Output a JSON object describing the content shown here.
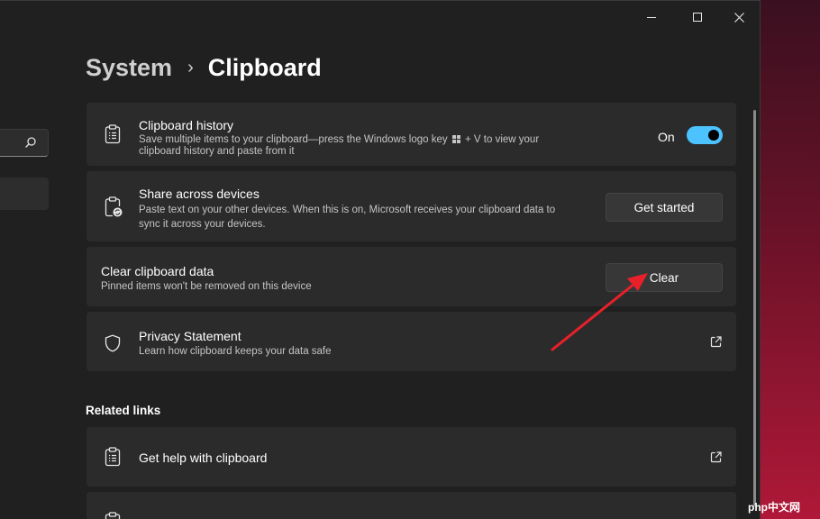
{
  "window": {
    "minimize_icon": "minimize-icon",
    "maximize_icon": "maximize-icon",
    "close_icon": "close-icon"
  },
  "breadcrumb": {
    "parent": "System",
    "separator": "›",
    "current": "Clipboard"
  },
  "settings": {
    "clipboard_history": {
      "title": "Clipboard history",
      "desc_line1": "Save multiple items to your clipboard—press the Windows logo key",
      "desc_key": "+ V to view your",
      "desc_line2": "clipboard history and paste from it",
      "toggle_label": "On",
      "toggle_on": true,
      "icon": "clipboard-list-icon"
    },
    "share_devices": {
      "title": "Share across devices",
      "desc_line1": "Paste text on your other devices. When this is on, Microsoft receives your clipboard data to",
      "desc_line2": "sync it across your devices.",
      "button": "Get started",
      "icon": "clipboard-sync-icon"
    },
    "clear_data": {
      "title": "Clear clipboard data",
      "desc": "Pinned items won't be removed on this device",
      "button": "Clear"
    },
    "privacy": {
      "title": "Privacy Statement",
      "desc": "Learn how clipboard keeps your data safe",
      "icon": "shield-icon"
    }
  },
  "related": {
    "title": "Related links",
    "items": [
      {
        "label": "Get help with clipboard",
        "icon": "clipboard-list-icon"
      },
      {
        "label": "",
        "icon": "clipboard-list-icon"
      }
    ]
  },
  "annotation": {
    "color": "#e8202a"
  },
  "watermark": "php中文网",
  "colors": {
    "accent": "#4cc2ff",
    "card": "#2b2b2b",
    "window": "#202020"
  }
}
